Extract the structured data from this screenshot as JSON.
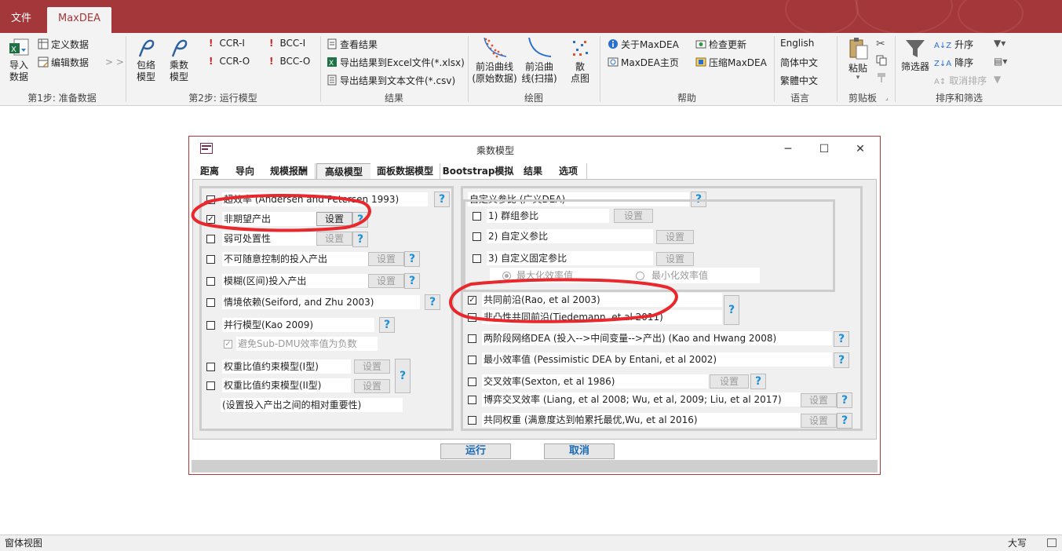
{
  "tabs": {
    "file": "文件",
    "maxdea": "MaxDEA"
  },
  "ribbon": {
    "import": "导入\n数据",
    "define_data": "定义数据",
    "edit_data": "编辑数据",
    "arrows": "> >",
    "group1": "第1步: 准备数据",
    "envelope": "包络\n模型",
    "multiplier": "乘数\n模型",
    "ccr_i": "CCR-I",
    "ccr_o": "CCR-O",
    "bcc_i": "BCC-I",
    "bcc_o": "BCC-O",
    "group2": "第2步: 运行模型",
    "view_results": "查看结果",
    "export_excel": "导出结果到Excel文件(*.xlsx)",
    "export_text": "导出结果到文本文件(*.csv)",
    "group3": "结果",
    "frontier_raw": "前沿曲线\n(原始数据)",
    "frontier_scan": "前沿曲\n线(扫描)",
    "scatter": "散\n点图",
    "group4": "绘图",
    "about": "关于MaxDEA",
    "homepage": "MaxDEA主页",
    "check_update": "检查更新",
    "compress": "压缩MaxDEA",
    "group5": "帮助",
    "english": "English",
    "simplified": "简体中文",
    "traditional": "繁體中文",
    "group6": "语言",
    "paste": "粘贴",
    "group7": "剪贴板",
    "filter": "筛选器",
    "asc": "升序",
    "desc": "降序",
    "cancel_sort": "取消排序",
    "group8": "排序和筛选"
  },
  "dialog": {
    "title": "乘数模型",
    "tabs": [
      "距离",
      "导向",
      "规模报酬",
      "高级模型",
      "面板数据模型",
      "Bootstrap模拟",
      "结果",
      "选项"
    ],
    "active_tab": "高级模型",
    "set_label": "设置",
    "help_label": "?",
    "left": {
      "super_eff": "超效率 (Andersen and Petersen 1993)",
      "undesirable": "非期望产出",
      "weak_disposal": "弱可处置性",
      "nondiscretionary": "不可随意控制的投入产出",
      "fuzzy": "模糊(区间)投入产出",
      "context": "情境依赖(Seiford, and Zhu 2003)",
      "parallel": "并行模型(Kao 2009)",
      "avoid_negative": "避免Sub-DMU效率值为负数",
      "weight_i": "权重比值约束模型(I型)",
      "weight_ii": "权重比值约束模型(II型)",
      "weight_note": "(设置投入产出之间的相对重要性)"
    },
    "right": {
      "custom_ref": "自定义参比 (广义DEA)",
      "group_ref": "1) 群组参比",
      "custom_ref2": "2) 自定义参比",
      "custom_fixed": "3) 自定义固定参比",
      "max_eff": "最大化效率值",
      "min_eff": "最小化效率值",
      "metafrontier": "共同前沿(Rao, et al 2003)",
      "nonconvex_meta": "非凸性共同前沿(Tiedemann, et al 2011)",
      "two_stage": "两阶段网络DEA (投入-->中间变量-->产出) (Kao and Hwang 2008)",
      "min_eff_model": "最小效率值 (Pessimistic DEA by Entani, et al 2002)",
      "cross_eff": "交叉效率(Sexton, et al 1986)",
      "game_cross": "博弈交叉效率 (Liang, et al 2008; Wu, et al, 2009; Liu, et al 2017)",
      "common_weight": "共同权重 (满意度达到帕累托最优,Wu, et al 2016)"
    },
    "run": "运行",
    "cancel": "取消",
    "checked": {
      "undesirable": true,
      "metafrontier": true,
      "avoid_negative": true
    }
  },
  "status": {
    "left": "窗体视图",
    "right": "大写"
  },
  "colors": {
    "accent": "#a4373a",
    "annotation": "#e8282c",
    "help_blue": "#1a8fd8"
  }
}
